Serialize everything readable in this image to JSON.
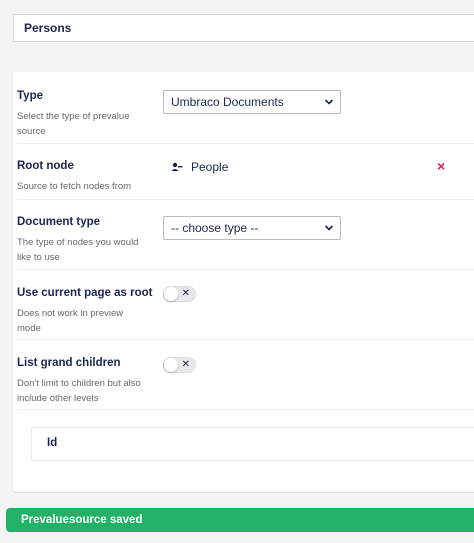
{
  "header": {
    "name": "Persons"
  },
  "fields": {
    "type": {
      "label": "Type",
      "description": "Select the type of prevalue source",
      "value": "Umbraco Documents"
    },
    "root_node": {
      "label": "Root node",
      "description": "Source to fetch nodes from",
      "node_name": "People",
      "remove_glyph": "×"
    },
    "document_type": {
      "label": "Document type",
      "description": "The type of nodes you would like to use",
      "value": "-- choose type --"
    },
    "use_current_page": {
      "label": "Use current page as root",
      "description": "Does not work in preview mode",
      "toggle_glyph": "✕"
    },
    "list_grand_children": {
      "label": "List grand children",
      "description": "Don't limit to children but also include other levels",
      "toggle_glyph": "✕"
    }
  },
  "table": {
    "column_id": "Id"
  },
  "notification": {
    "text": "Prevaluesource saved"
  },
  "colors": {
    "accent": "#21b267",
    "remove": "#d42054",
    "text": "#1b264f"
  },
  "icons": {
    "root_node": "node-icon",
    "remove": "close-icon",
    "select_caret": "chevron-down-icon"
  }
}
